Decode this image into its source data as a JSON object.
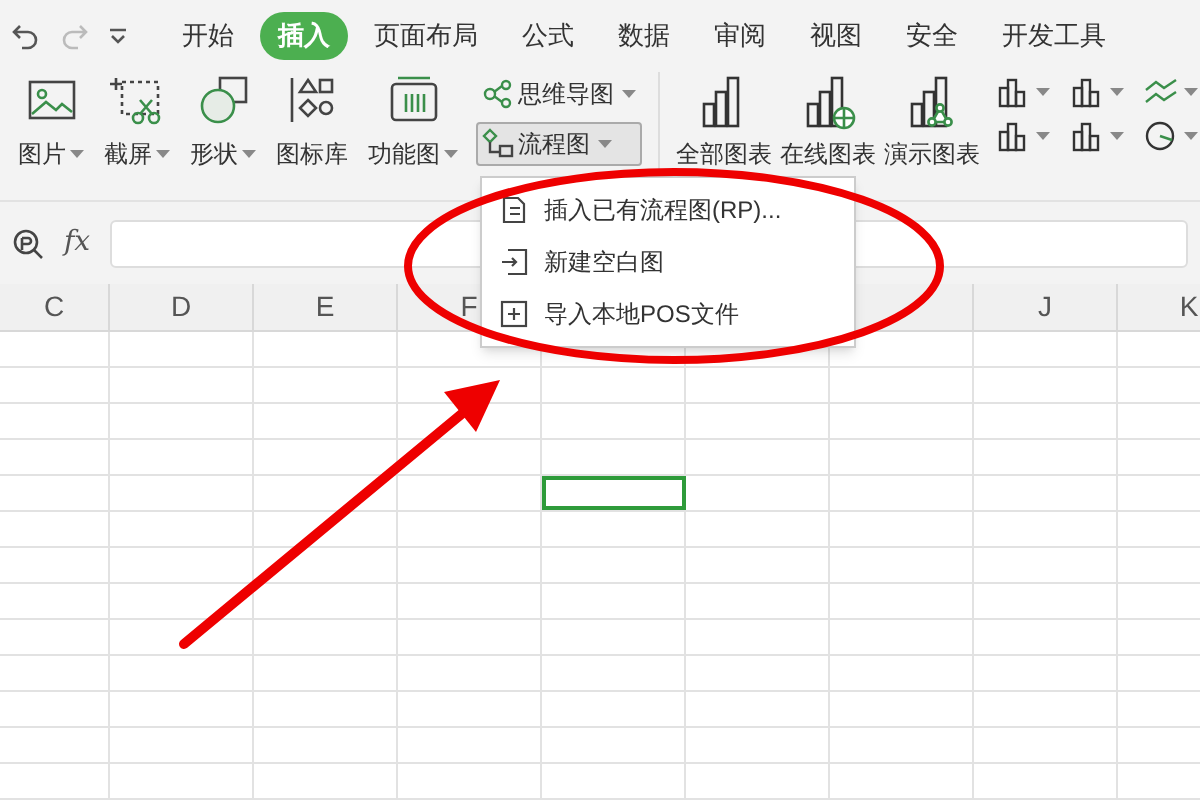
{
  "quick_access": {
    "redo_disabled": true
  },
  "tabs": [
    {
      "label": "开始",
      "selected": false
    },
    {
      "label": "插入",
      "selected": true
    },
    {
      "label": "页面布局",
      "selected": false
    },
    {
      "label": "公式",
      "selected": false
    },
    {
      "label": "数据",
      "selected": false
    },
    {
      "label": "审阅",
      "selected": false
    },
    {
      "label": "视图",
      "selected": false
    },
    {
      "label": "安全",
      "selected": false
    },
    {
      "label": "开发工具",
      "selected": false
    }
  ],
  "ribbon": {
    "large_buttons": [
      {
        "label": "图片",
        "kind": "picture",
        "dropdown": true
      },
      {
        "label": "截屏",
        "kind": "screenshot",
        "dropdown": true
      },
      {
        "label": "形状",
        "kind": "shapes",
        "dropdown": true
      },
      {
        "label": "图标库",
        "kind": "iconlib",
        "dropdown": false
      },
      {
        "label": "功能图",
        "kind": "function",
        "dropdown": true
      }
    ],
    "small_buttons": [
      {
        "label": "思维导图",
        "kind": "mindmap",
        "pressed": false
      },
      {
        "label": "流程图",
        "kind": "flowchart",
        "pressed": true
      }
    ],
    "chart_buttons": [
      {
        "label": "全部图表",
        "kind": "all"
      },
      {
        "label": "在线图表",
        "kind": "online"
      },
      {
        "label": "演示图表",
        "kind": "demo"
      }
    ]
  },
  "formula_bar": {
    "fx": "fx"
  },
  "columns": [
    "C",
    "D",
    "E",
    "F",
    "J",
    "K"
  ],
  "menu": {
    "items": [
      {
        "label": "插入已有流程图(RP)...",
        "kind": "file"
      },
      {
        "label": "新建空白图",
        "kind": "new"
      },
      {
        "label": "导入本地POS文件",
        "kind": "import"
      }
    ]
  }
}
